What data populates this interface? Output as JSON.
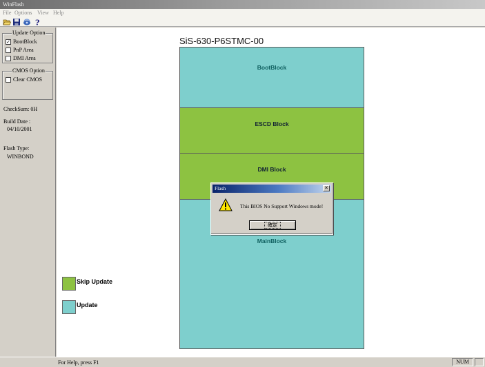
{
  "window": {
    "title": "WinFlash"
  },
  "menu": {
    "file": "File",
    "options": "Options",
    "view": "View",
    "help": "Help"
  },
  "toolbar": {
    "icons": [
      "open-icon",
      "save-icon",
      "flash-icon",
      "help-icon"
    ]
  },
  "sidebar": {
    "update_option": {
      "title": "Update Option",
      "items": [
        {
          "label": "BootBlock",
          "checked": true
        },
        {
          "label": "PnP Area",
          "checked": false
        },
        {
          "label": "DMI Area",
          "checked": false
        }
      ]
    },
    "cmos_option": {
      "title": "CMOS Option",
      "items": [
        {
          "label": "Clear CMOS",
          "checked": false
        }
      ]
    },
    "checksum": "CheckSum:  0H",
    "build_date_label": "Build Date :",
    "build_date": "04/10/2001",
    "flash_type_label": "Flash Type:",
    "flash_type": "WINBOND"
  },
  "main": {
    "bios_title": "SiS-630-P6STMC-00",
    "blocks": [
      {
        "label": "BootBlock",
        "kind": "update"
      },
      {
        "label": "ESCD Block",
        "kind": "skip"
      },
      {
        "label": "DMI Block",
        "kind": "skip"
      },
      {
        "label": "MainBlock",
        "kind": "update"
      }
    ],
    "legend": {
      "skip_label": "Skip Update",
      "update_label": "Update"
    }
  },
  "colors": {
    "update": "#7ecfcd",
    "skip": "#8dc241"
  },
  "dialog": {
    "title": "Flash",
    "message": "This BIOS No Support Windows mode!",
    "ok_label": "確定",
    "icon": "warning-icon"
  },
  "status": {
    "text": "For Help, press F1",
    "num": "NUM"
  }
}
